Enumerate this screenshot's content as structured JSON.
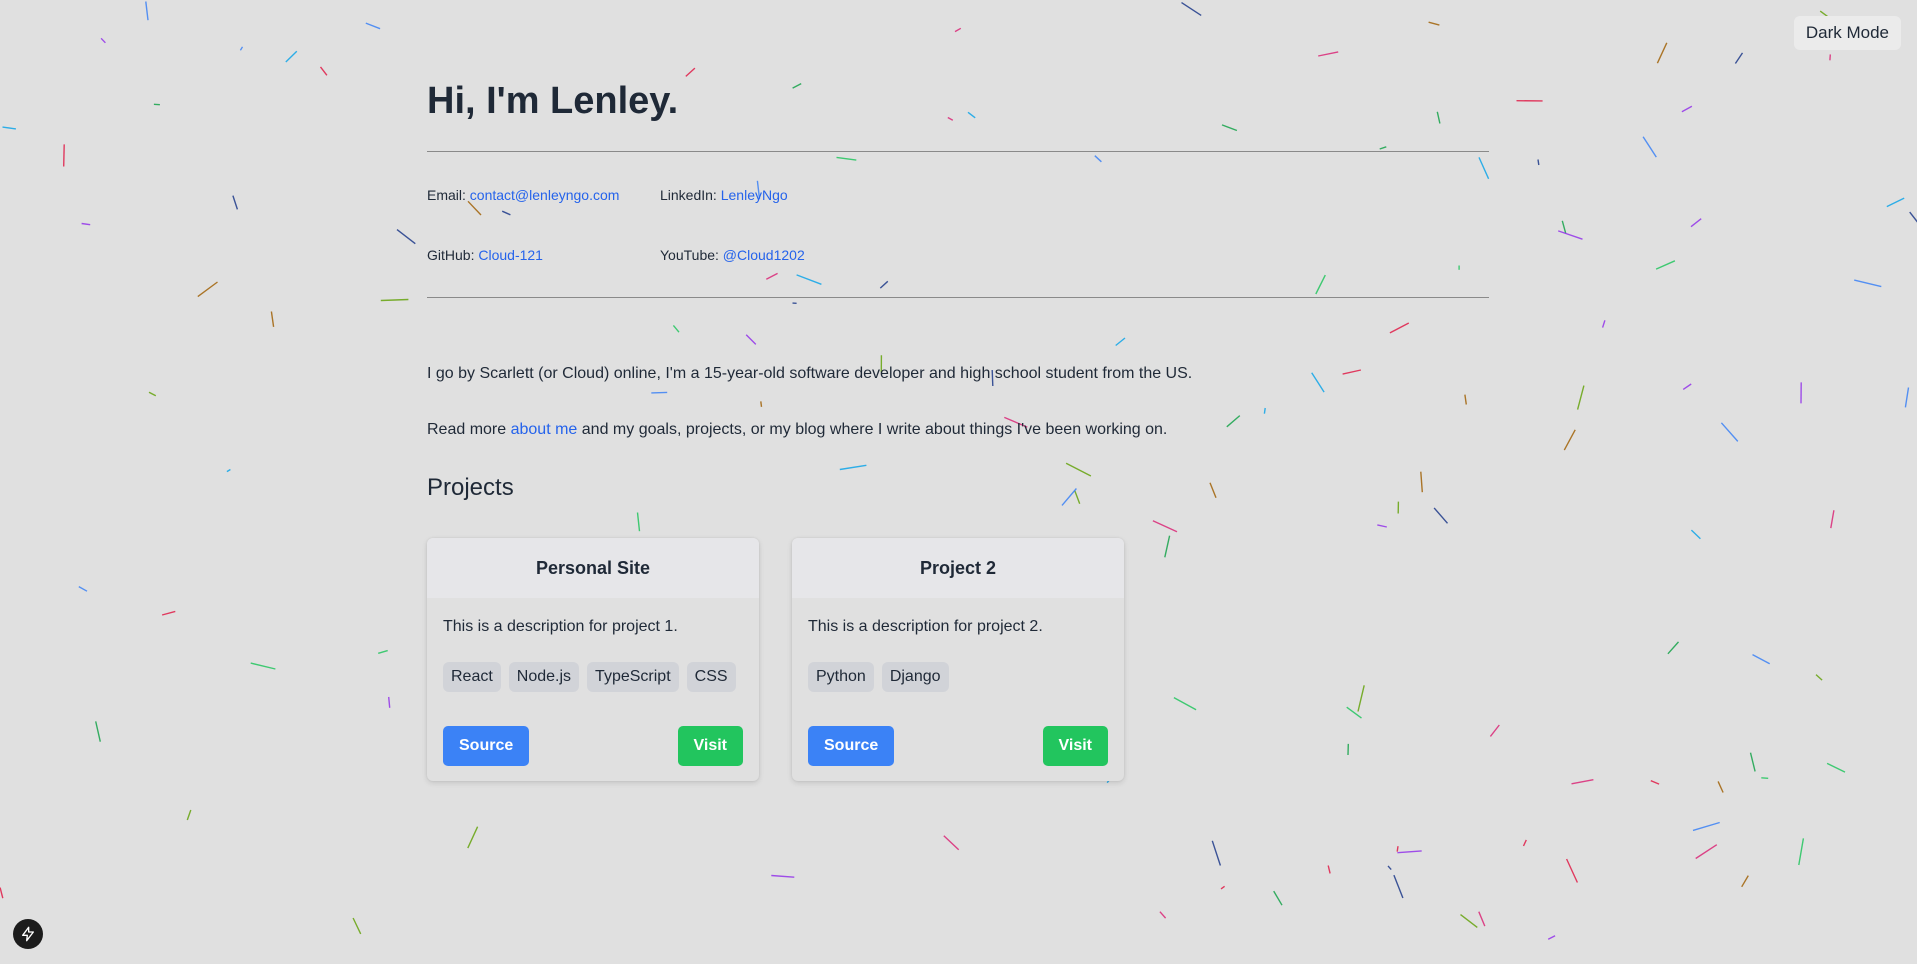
{
  "header": {
    "dark_mode_label": "Dark Mode"
  },
  "hero": {
    "title": "Hi, I'm Lenley."
  },
  "contacts": [
    {
      "label": "Email:",
      "value": "contact@lenleyngo.com"
    },
    {
      "label": "LinkedIn:",
      "value": "LenleyNgo"
    },
    {
      "label": "GitHub:",
      "value": "Cloud-121"
    },
    {
      "label": "YouTube:",
      "value": "@Cloud1202"
    }
  ],
  "intro": {
    "line1": "I go by Scarlett (or Cloud) online, I'm a 15-year-old software developer and high school student from the US.",
    "line2_prefix": "Read more",
    "line2_link": "about me",
    "line2_suffix": "and my goals, projects, or my blog where I write about things I've been working on."
  },
  "projects": {
    "heading": "Projects",
    "items": [
      {
        "title": "Personal Site",
        "description": "This is a description for project 1.",
        "tags": [
          "React",
          "Node.js",
          "TypeScript",
          "CSS"
        ],
        "source_label": "Source",
        "visit_label": "Visit"
      },
      {
        "title": "Project 2",
        "description": "This is a description for project 2.",
        "tags": [
          "Python",
          "Django"
        ],
        "source_label": "Source",
        "visit_label": "Visit"
      }
    ]
  },
  "colors": {
    "background": "#e0e0e0",
    "text": "#1f2937",
    "link": "#2563eb",
    "source_button": "#3b82f6",
    "visit_button": "#22c55e",
    "confetti": [
      "#e11d48",
      "#65a30d",
      "#1e3a8a",
      "#16a34a",
      "#db2777",
      "#22c55e",
      "#3b82f6",
      "#a16207",
      "#9333ea",
      "#0ea5e9"
    ]
  },
  "icons": {
    "floating_button": "lightning-bolt-icon"
  }
}
